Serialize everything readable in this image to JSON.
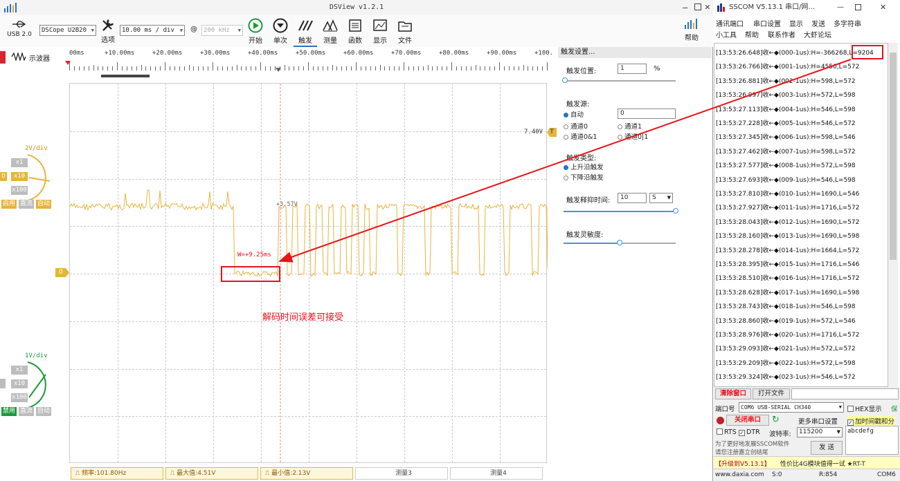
{
  "dsview": {
    "title": "DSView v1.2.1",
    "usb_label": "USB 2.0",
    "scope_label": "示波器",
    "device_select": "DSCope U2B20",
    "options_label": "选项",
    "timebase_select": "10.00 ms / div",
    "at_symbol": "@",
    "samplerate_select": "200 kHz",
    "toolbar": [
      {
        "name": "start",
        "label": "开始",
        "icon": "play-icon"
      },
      {
        "name": "single",
        "label": "单次",
        "icon": "single-icon"
      },
      {
        "name": "trigger",
        "label": "触发",
        "icon": "trigger-icon"
      },
      {
        "name": "measure",
        "label": "测量",
        "icon": "measure-icon"
      },
      {
        "name": "function",
        "label": "函数",
        "icon": "function-icon"
      },
      {
        "name": "display",
        "label": "显示",
        "icon": "display-icon"
      },
      {
        "name": "file",
        "label": "文件",
        "icon": "file-icon"
      }
    ],
    "help_label": "帮助",
    "ruler_labels": [
      "00ms",
      "+10.00ms",
      "+20.00ms",
      "+30.00ms",
      "+40.00ms",
      "+50.00ms",
      "+60.00ms",
      "+70.00ms",
      "+80.00ms",
      "+90.00ms",
      "+100."
    ],
    "ch0": {
      "volts_div": "2V/div",
      "x1": "x1",
      "x10": "x10",
      "x100": "x100",
      "enable": "启用",
      "coupling": "直流",
      "auto": "自动",
      "zero_marker": "0"
    },
    "ch1": {
      "volts_div": "1V/div",
      "x1": "x1",
      "x10": "x10",
      "x100": "x100",
      "enable": "禁用",
      "coupling": "直流",
      "auto": "自动"
    },
    "trigger_level_label": "7.40V",
    "trigger_marker": "T",
    "cursor_voltage": "+3.57V",
    "width_annotation": "W=+9.25ms",
    "annotation_text": "解码时间误差可接受",
    "measurements": [
      {
        "label": "频率:101.80Hz",
        "active": true
      },
      {
        "label": "最大值:4.51V",
        "active": true
      },
      {
        "label": "最小值:2.13V",
        "active": true
      },
      {
        "label": "测量3",
        "active": false
      },
      {
        "label": "测量4",
        "active": false
      }
    ],
    "colors": {
      "channel0": "#e6b43c",
      "channel1": "#1a9a3a",
      "annotation": "#e8121b"
    }
  },
  "trigger_panel": {
    "header": "触发设置...",
    "position_label": "触发位置:",
    "position_value": "1",
    "position_unit": "%",
    "source_label": "触发源:",
    "source_options": [
      "自动",
      "通道0",
      "通道0&1",
      "通道1",
      "通道0|1"
    ],
    "source_selected": "自动",
    "source_value": "0",
    "type_label": "触发类型:",
    "type_options": [
      "上升沿触发",
      "下降沿触发"
    ],
    "type_selected": "上升沿触发",
    "holdoff_label": "触发释抑时间:",
    "holdoff_value": "10",
    "holdoff_unit": "S",
    "sensitivity_label": "触发灵敏度:",
    "position_fraction": 0.01,
    "holdoff_fraction": 1.0,
    "sensitivity_fraction": 0.5
  },
  "sscom": {
    "title": "SSCOM V5.13.1 串口/网...",
    "menu_row1": [
      "通讯端口",
      "串口设置",
      "显示",
      "发送",
      "多字符串"
    ],
    "menu_row2": [
      "小工具",
      "帮助",
      "联系作者",
      "大虾论坛"
    ],
    "log_lines": [
      "[13:53:26.648]收←◆(000-1us):H=-366268,L=9204",
      "[13:53:26.766]收←◆(001-1us):H=4550,L=572",
      "[13:53:26.881]收←◆(002-1us):H=598,L=572",
      "[13:53:26.997]收←◆(003-1us):H=572,L=598",
      "[13:53:27.113]收←◆(004-1us):H=546,L=598",
      "[13:53:27.228]收←◆(005-1us):H=546,L=572",
      "[13:53:27.345]收←◆(006-1us):H=598,L=546",
      "[13:53:27.462]收←◆(007-1us):H=598,L=572",
      "[13:53:27.577]收←◆(008-1us):H=572,L=598",
      "[13:53:27.693]收←◆(009-1us):H=546,L=598",
      "[13:53:27.810]收←◆(010-1us):H=1690,L=546",
      "[13:53:27.927]收←◆(011-1us):H=1716,L=572",
      "[13:53:28.043]收←◆(012-1us):H=1690,L=572",
      "[13:53:28.160]收←◆(013-1us):H=1690,L=598",
      "[13:53:28.278]收←◆(014-1us):H=1664,L=572",
      "[13:53:28.395]收←◆(015-1us):H=1716,L=546",
      "[13:53:28.510]收←◆(016-1us):H=1716,L=572",
      "[13:53:28.628]收←◆(017-1us):H=1690,L=598",
      "[13:53:28.743]收←◆(018-1us):H=546,L=598",
      "[13:53:28.860]收←◆(019-1us):H=572,L=546",
      "[13:53:28.976]收←◆(020-1us):H=1716,L=572",
      "[13:53:29.093]收←◆(021-1us):H=572,L=572",
      "[13:53:29.209]收←◆(022-1us):H=572,L=598",
      "[13:53:29.324]收←◆(023-1us):H=546,L=572"
    ],
    "clear_button": "清除窗口",
    "open_file_button": "打开文件",
    "port_label": "端口号",
    "port_value": "COM6 USB-SERIAL CH340",
    "hex_display": "HEX显示",
    "save_label": "保",
    "close_port_button": "关闭串口",
    "more_settings": "更多串口设置",
    "add_timestamp": "加时间戳和分",
    "rts_label": "RTS",
    "dtr_label": "DTR",
    "baud_label": "波特率:",
    "baud_value": "115200",
    "send_text": "abcdefg",
    "send_button": "发 送",
    "promo_line1": "为了更好地发展SSCOM软件",
    "promo_line2": "请您注册嘉立创结尾",
    "upgrade_text": "【升级到V5.13.1】",
    "promo_line3": "性价比4G模块值得一试 ★RT-T",
    "status_url": "www.daxia.com",
    "status_s": "S:0",
    "status_r": "R:854",
    "status_com": "COM6"
  }
}
